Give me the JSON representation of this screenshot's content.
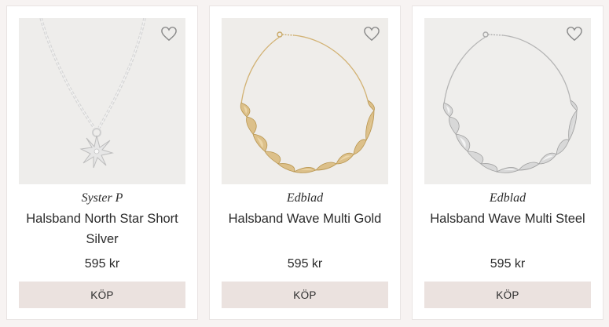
{
  "products": [
    {
      "brand": "Syster P",
      "name": "Halsband North Star Short Silver",
      "price": "595 kr",
      "buy_label": "KÖP",
      "wishlist_icon": "heart-outline-icon",
      "metal_color": "#d3d3d3"
    },
    {
      "brand": "Edblad",
      "name": "Halsband Wave Multi Gold",
      "price": "595 kr",
      "buy_label": "KÖP",
      "wishlist_icon": "heart-outline-icon",
      "metal_color": "#d6b678"
    },
    {
      "brand": "Edblad",
      "name": "Halsband Wave Multi Steel",
      "price": "595 kr",
      "buy_label": "KÖP",
      "wishlist_icon": "heart-outline-icon",
      "metal_color": "#c9c9c9"
    }
  ],
  "colors": {
    "page_background": "#f7f3f2",
    "card_background": "#ffffff",
    "image_background": "#eeedeb",
    "buy_button": "#ebe2df",
    "text": "#2b2b2b"
  }
}
